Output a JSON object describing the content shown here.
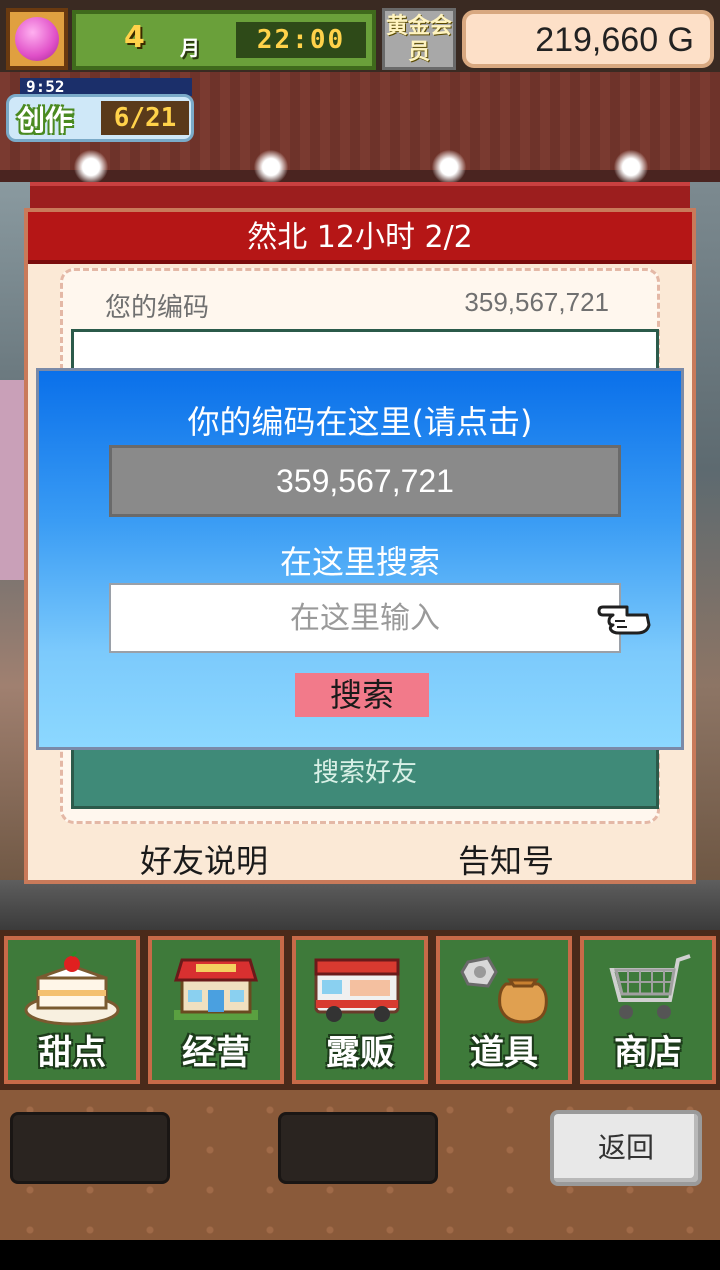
{
  "hud": {
    "month_number": "4",
    "month_label": "月",
    "time": "22:00",
    "member_label": "黄金会员",
    "gold": "219,660 G"
  },
  "create": {
    "timer": "9:52",
    "label": "创作",
    "count": "6/21"
  },
  "panel": {
    "title": "然北  12小时 2/2",
    "code_label": "您的编码",
    "code_value": "359,567,721",
    "search_friend": "搜索好友",
    "footer_left": "好友说明",
    "footer_right": "告知号"
  },
  "dialog": {
    "title": "你的编码在这里(请点击)",
    "code": "359,567,721",
    "search_label": "在这里搜索",
    "search_placeholder": "在这里输入",
    "search_button": "搜索"
  },
  "menu": [
    {
      "label": "甜点",
      "icon": "cake-icon"
    },
    {
      "label": "经营",
      "icon": "shop-icon"
    },
    {
      "label": "露贩",
      "icon": "food-truck-icon"
    },
    {
      "label": "道具",
      "icon": "items-bag-icon"
    },
    {
      "label": "商店",
      "icon": "shopping-cart-icon"
    }
  ],
  "back_button": "返回"
}
